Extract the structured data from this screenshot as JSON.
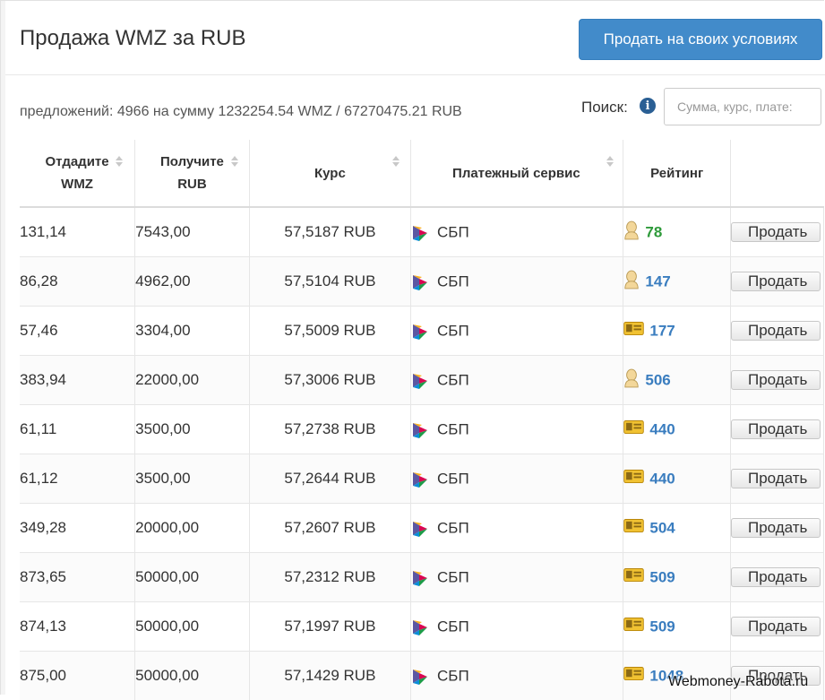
{
  "header": {
    "title": "Продажа WMZ за RUB",
    "sell_button": "Продать на своих условиях"
  },
  "summary": "предложений: 4966 на сумму 1232254.54 WMZ / 67270475.21 RUB",
  "search": {
    "label": "Поиск:",
    "placeholder": "Сумма, курс, плате:"
  },
  "table": {
    "headers": {
      "give_line1": "Отдадите",
      "give_line2": "WMZ",
      "get_line1": "Получите",
      "get_line2": "RUB",
      "rate": "Курс",
      "payment": "Платежный сервис",
      "rating": "Рейтинг"
    },
    "rows": [
      {
        "give": "131,14",
        "get": "7543,00",
        "rate": "57,5187 RUB",
        "payment": "СБП",
        "rating_icon": "person-icon",
        "rating": "78"
      },
      {
        "give": "86,28",
        "get": "4962,00",
        "rate": "57,5104 RUB",
        "payment": "СБП",
        "rating_icon": "person-icon",
        "rating": "147"
      },
      {
        "give": "57,46",
        "get": "3304,00",
        "rate": "57,5009 RUB",
        "payment": "СБП",
        "rating_icon": "id-card-icon",
        "rating": "177"
      },
      {
        "give": "383,94",
        "get": "22000,00",
        "rate": "57,3006 RUB",
        "payment": "СБП",
        "rating_icon": "person-icon",
        "rating": "506"
      },
      {
        "give": "61,11",
        "get": "3500,00",
        "rate": "57,2738 RUB",
        "payment": "СБП",
        "rating_icon": "id-card-icon",
        "rating": "440"
      },
      {
        "give": "61,12",
        "get": "3500,00",
        "rate": "57,2644 RUB",
        "payment": "СБП",
        "rating_icon": "id-card-icon",
        "rating": "440"
      },
      {
        "give": "349,28",
        "get": "20000,00",
        "rate": "57,2607 RUB",
        "payment": "СБП",
        "rating_icon": "id-card-icon",
        "rating": "504"
      },
      {
        "give": "873,65",
        "get": "50000,00",
        "rate": "57,2312 RUB",
        "payment": "СБП",
        "rating_icon": "id-card-icon",
        "rating": "509"
      },
      {
        "give": "874,13",
        "get": "50000,00",
        "rate": "57,1997 RUB",
        "payment": "СБП",
        "rating_icon": "id-card-icon",
        "rating": "509"
      },
      {
        "give": "875,00",
        "get": "50000,00",
        "rate": "57,1429 RUB",
        "payment": "СБП",
        "rating_icon": "id-card-icon",
        "rating": "1048"
      }
    ],
    "action_label": "Продать"
  },
  "watermark": "Webmoney-Rabota.ru",
  "colors": {
    "accent": "#428bca",
    "link": "#3a7dbf",
    "rating_green": "#2e9a3a"
  }
}
